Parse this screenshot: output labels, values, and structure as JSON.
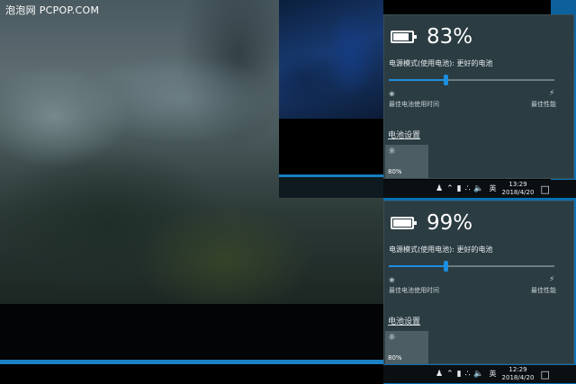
{
  "watermark": "泡泡网 PCPOP.COM",
  "flyouts": [
    {
      "battery_percent": "83%",
      "power_mode_label": "电源模式(使用电池): 更好的电池",
      "slider_level": 0.34,
      "slider_left_label": "最佳电池使用时间",
      "slider_right_label": "最佳性能",
      "settings_link": "电池设置",
      "brightness_tile": "80%",
      "icons": {
        "battery": "battery-icon",
        "leaf": "leaf-icon",
        "bolt": "bolt-icon",
        "sun": "sun-icon"
      }
    },
    {
      "battery_percent": "99%",
      "power_mode_label": "电源模式(使用电池): 更好的电池",
      "slider_level": 0.34,
      "slider_left_label": "最佳电池使用时间",
      "slider_right_label": "最佳性能",
      "settings_link": "电池设置",
      "brightness_tile": "80%",
      "icons": {
        "battery": "battery-icon",
        "leaf": "leaf-icon",
        "bolt": "bolt-icon",
        "sun": "sun-icon"
      }
    }
  ],
  "taskbars": [
    {
      "time": "13:29",
      "date": "2018/4/20",
      "ime": "英"
    },
    {
      "time": "12:29",
      "date": "2018/4/20",
      "ime": "英"
    }
  ],
  "colors": {
    "accent": "#1d8fe0",
    "panel": "#2b3c42",
    "taskbar": "#0b0f12",
    "desktop_blue": "#0a6fb3"
  }
}
